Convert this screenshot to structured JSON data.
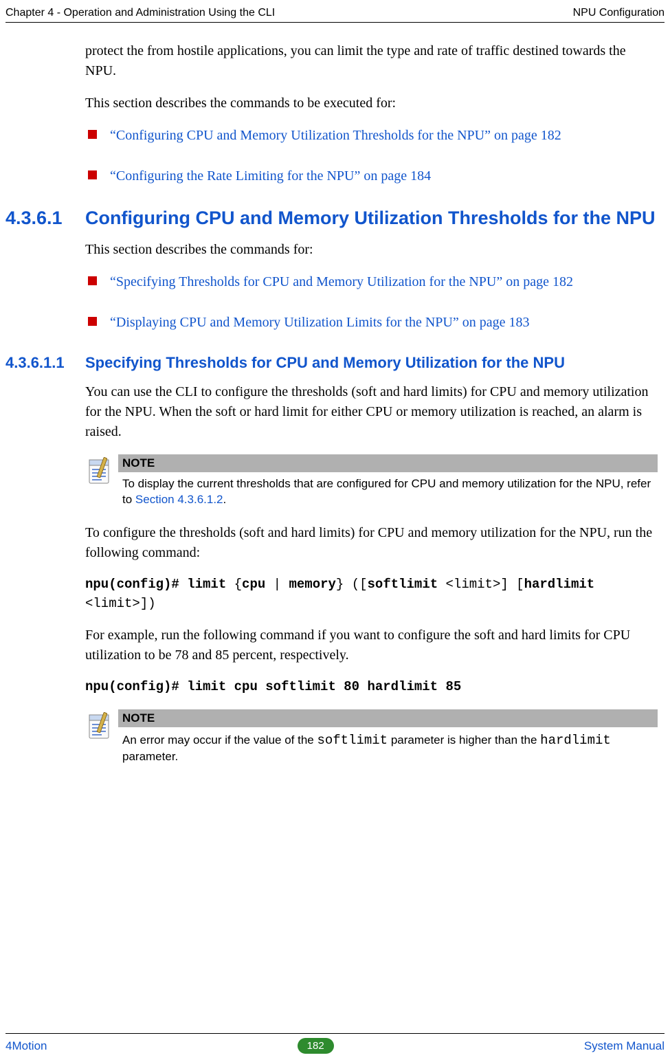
{
  "header": {
    "left": "Chapter 4 - Operation and Administration Using the CLI",
    "right": "NPU Configuration"
  },
  "intro": {
    "p1": "protect the from hostile applications, you can limit the type and rate of traffic destined towards the NPU.",
    "p2": "This section describes the commands to be executed for:",
    "bullets": [
      "“Configuring CPU and Memory Utilization Thresholds for the NPU” on page 182",
      "“Configuring the Rate Limiting for the NPU” on page 184"
    ]
  },
  "sec43611": {
    "num": "4.3.6.1",
    "title": "Configuring CPU and Memory Utilization Thresholds for the NPU",
    "p1": "This section describes the commands for:",
    "bullets": [
      "“Specifying Thresholds for CPU and Memory Utilization for the NPU” on page 182",
      "“Displaying CPU and Memory Utilization Limits for the NPU” on page 183"
    ]
  },
  "sec436111": {
    "num": "4.3.6.1.1",
    "title": "Specifying Thresholds for CPU and Memory Utilization for the NPU",
    "p1": "You can use the CLI to configure the thresholds (soft and hard limits) for CPU and memory utilization for the NPU. When the soft or hard limit for either CPU or memory utilization is reached, an alarm is raised."
  },
  "note1": {
    "label": "NOTE",
    "text_pre": "To display the current thresholds that are configured for CPU and memory utilization for the NPU, refer to ",
    "ref": "Section 4.3.6.1.2",
    "text_post": "."
  },
  "after_note": {
    "p1": "To configure the thresholds (soft and hard limits) for CPU and memory utilization for the NPU, run the following command:",
    "cmd1": {
      "b1": "npu(config)# limit",
      "t1": " {",
      "b2": "cpu",
      "t2": " | ",
      "b3": "memory",
      "t3": "} ([",
      "b4": "softlimit",
      "t4": " <limit>] [",
      "b5": "hardlimit",
      "t5": " <limit>])"
    },
    "p2": "For example, run the following command if you want to configure the soft and hard limits for CPU utilization to be 78 and 85 percent, respectively.",
    "cmd2": "npu(config)# limit cpu softlimit 80 hardlimit 85"
  },
  "note2": {
    "label": "NOTE",
    "pre": "An error may occur if the value of the ",
    "c1": "softlimit",
    "mid": " parameter is higher than the ",
    "c2": "hardlimit",
    "post": " parameter."
  },
  "footer": {
    "left": "4Motion",
    "page": "182",
    "right": "System Manual"
  }
}
